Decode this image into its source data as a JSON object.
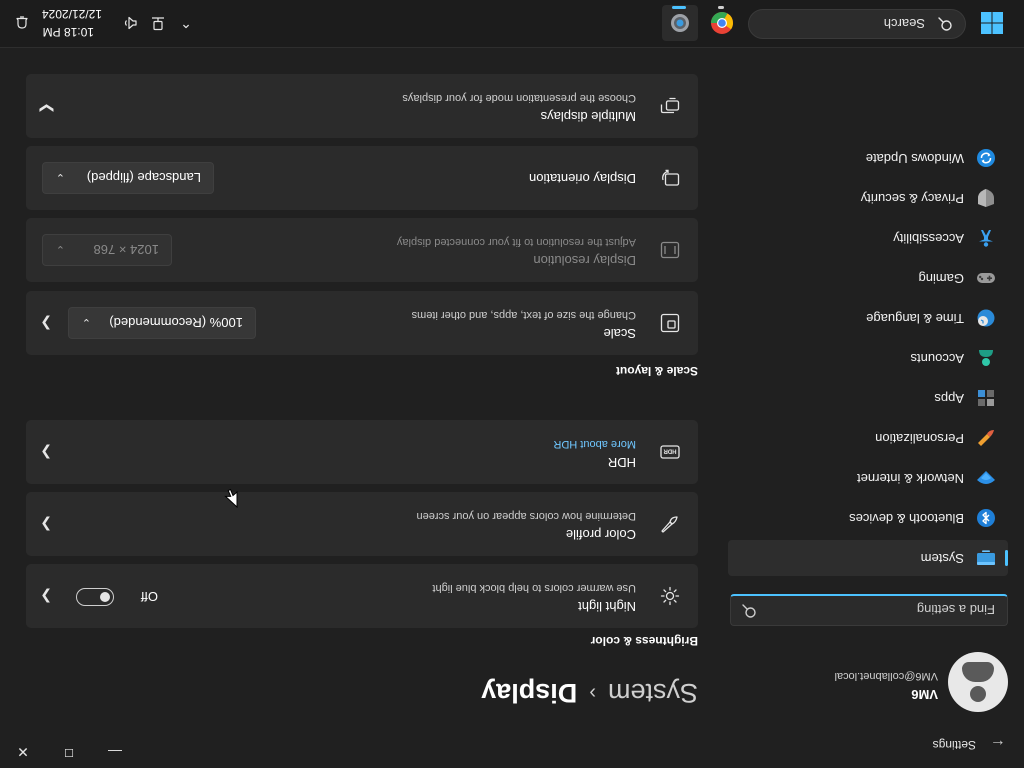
{
  "app": {
    "title": "Settings"
  },
  "profile": {
    "name": "VM6",
    "email": "VM6@collabnet.local"
  },
  "search": {
    "placeholder": "Find a setting"
  },
  "nav": [
    {
      "label": "System",
      "icon": "monitor-icon",
      "active": true
    },
    {
      "label": "Bluetooth & devices",
      "icon": "bluetooth-icon"
    },
    {
      "label": "Network & internet",
      "icon": "wifi-icon"
    },
    {
      "label": "Personalization",
      "icon": "brush-icon"
    },
    {
      "label": "Apps",
      "icon": "apps-icon"
    },
    {
      "label": "Accounts",
      "icon": "person-icon"
    },
    {
      "label": "Time & language",
      "icon": "globe-clock-icon"
    },
    {
      "label": "Gaming",
      "icon": "gamepad-icon"
    },
    {
      "label": "Accessibility",
      "icon": "accessibility-icon"
    },
    {
      "label": "Privacy & security",
      "icon": "shield-icon"
    },
    {
      "label": "Windows Update",
      "icon": "sync-icon"
    }
  ],
  "breadcrumb": {
    "parent": "System",
    "separator": "›",
    "current": "Display"
  },
  "sections": {
    "brightness": "Brightness & color",
    "scale": "Scale & layout"
  },
  "cards": {
    "night_light": {
      "title": "Night light",
      "subtitle": "Use warmer colors to help block blue light",
      "toggle_label": "Off"
    },
    "color_profile": {
      "title": "Color profile",
      "subtitle": "Determine how colors appear on your screen"
    },
    "hdr": {
      "title": "HDR",
      "subtitle": "More about HDR"
    },
    "scale": {
      "title": "Scale",
      "subtitle": "Change the size of text, apps, and other items",
      "value": "100% (Recommended)"
    },
    "resolution": {
      "title": "Display resolution",
      "subtitle": "Adjust the resolution to fit your connected display",
      "value": "1024 × 768"
    },
    "orientation": {
      "title": "Display orientation",
      "value": "Landscape (flipped)"
    },
    "multiple": {
      "title": "Multiple displays",
      "subtitle": "Choose the presentation mode for your displays"
    }
  },
  "taskbar": {
    "search_label": "Search",
    "time": "10:18 PM",
    "date": "12/21/2024"
  },
  "colors": {
    "accent": "#4cc2ff",
    "background": "#202020",
    "card": "#2b2b2b"
  }
}
